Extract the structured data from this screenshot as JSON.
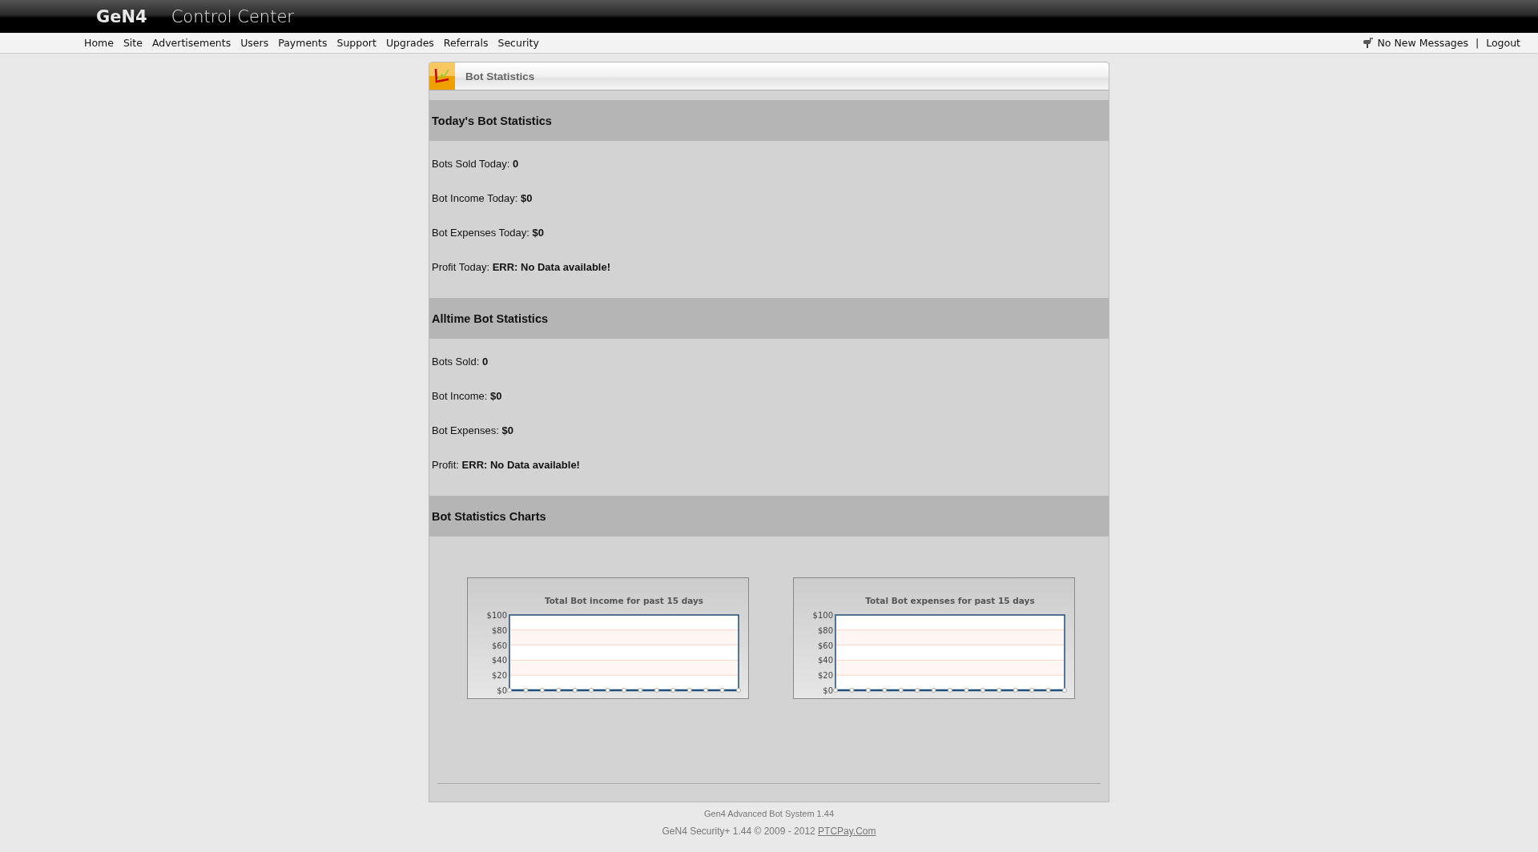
{
  "header": {
    "logo": "GeN4",
    "title": "Control Center"
  },
  "nav": {
    "items": [
      {
        "label": "Home"
      },
      {
        "label": "Site"
      },
      {
        "label": "Advertisements"
      },
      {
        "label": "Users"
      },
      {
        "label": "Payments"
      },
      {
        "label": "Support"
      },
      {
        "label": "Upgrades"
      },
      {
        "label": "Referrals"
      },
      {
        "label": "Security"
      }
    ],
    "messages": "No New Messages",
    "separator": "|",
    "logout": "Logout"
  },
  "panel": {
    "title": "Bot Statistics",
    "sections": [
      {
        "heading": "Today's Bot Statistics",
        "rows": [
          {
            "label": "Bots Sold Today:",
            "value": "0"
          },
          {
            "label": "Bot Income Today:",
            "value": "$0"
          },
          {
            "label": "Bot Expenses Today:",
            "value": "$0"
          },
          {
            "label": "Profit Today:",
            "value": "ERR: No Data available!"
          }
        ]
      },
      {
        "heading": "Alltime Bot Statistics",
        "rows": [
          {
            "label": "Bots Sold:",
            "value": "0"
          },
          {
            "label": "Bot Income:",
            "value": "$0"
          },
          {
            "label": "Bot Expenses:",
            "value": "$0"
          },
          {
            "label": "Profit:",
            "value": "ERR: No Data available!"
          }
        ]
      },
      {
        "heading": "Bot Statistics Charts",
        "charts": [
          {
            "chart_data": {
              "type": "line",
              "title": "Total Bot income for past 15 days",
              "ylim": [
                0,
                100
              ],
              "yticks": [
                {
                  "value": 0,
                  "label": "$0"
                },
                {
                  "value": 20,
                  "label": "$20"
                },
                {
                  "value": 40,
                  "label": "$40"
                },
                {
                  "value": 60,
                  "label": "$60"
                },
                {
                  "value": 80,
                  "label": "$80"
                },
                {
                  "value": 100,
                  "label": "$100"
                }
              ],
              "grid": true,
              "series": [
                {
                  "color": "#1f4e79",
                  "marker": true,
                  "values": [
                    0,
                    0,
                    0,
                    0,
                    0,
                    0,
                    0,
                    0,
                    0,
                    0,
                    0,
                    0,
                    0,
                    0,
                    0
                  ]
                }
              ]
            }
          },
          {
            "chart_data": {
              "type": "line",
              "title": "Total Bot expenses for past 15 days",
              "ylim": [
                0,
                100
              ],
              "yticks": [
                {
                  "value": 0,
                  "label": "$0"
                },
                {
                  "value": 20,
                  "label": "$20"
                },
                {
                  "value": 40,
                  "label": "$40"
                },
                {
                  "value": 60,
                  "label": "$60"
                },
                {
                  "value": 80,
                  "label": "$80"
                },
                {
                  "value": 100,
                  "label": "$100"
                }
              ],
              "grid": true,
              "series": [
                {
                  "color": "#1f4e79",
                  "marker": true,
                  "values": [
                    0,
                    0,
                    0,
                    0,
                    0,
                    0,
                    0,
                    0,
                    0,
                    0,
                    0,
                    0,
                    0,
                    0,
                    0
                  ]
                }
              ]
            }
          }
        ]
      }
    ]
  },
  "footer": {
    "system": "Gen4 Advanced Bot System 1.44",
    "copyright": "GeN4 Security+ 1.44 © 2009 - 2012",
    "link": "PTCPay.Com"
  }
}
